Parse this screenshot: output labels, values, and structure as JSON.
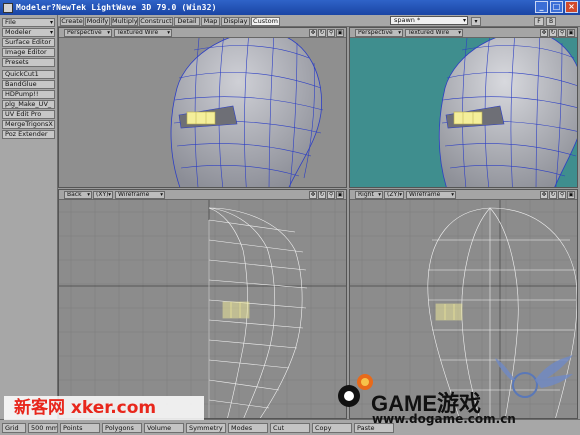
{
  "window": {
    "title": "Modeler?NewTek LightWave 3D 79.0 (Win32)",
    "buttons": [
      "_",
      "□",
      "×"
    ]
  },
  "left_panel": {
    "file": "File",
    "modeler": "Modeler",
    "items": [
      "Surface Editor",
      "Image Editor",
      "Presets"
    ],
    "plugins": [
      "QuickCut1",
      "BandGlue",
      "HDPump!!",
      "plg_Make_UV_",
      "UV Edit Pro",
      "MergeTrigonsX",
      "Poz Extender"
    ]
  },
  "tabs": [
    "Create",
    "Modify",
    "Multiply",
    "Construct",
    "Detail",
    "Map",
    "Display",
    "Custom"
  ],
  "active_tab": "Custom",
  "layer_select": "spawn *",
  "viewports": [
    {
      "view": "Perspective",
      "mode": "Textured Wire",
      "axis": ""
    },
    {
      "view": "Perspective",
      "mode": "Textured Wire",
      "axis": ""
    },
    {
      "view": "Back",
      "axis": "(XY)",
      "mode": "Wireframe"
    },
    {
      "view": "Right",
      "axis": "(ZY)",
      "mode": "Wireframe"
    }
  ],
  "bottom_bar": {
    "items": [
      "Grid",
      "500 mm",
      "Points",
      "Polygons",
      "Volume",
      "Symmetry",
      "Modes",
      "Cut",
      "Copy",
      "Paste"
    ]
  },
  "watermarks": {
    "left": "新客网 xker.com",
    "logo_text": "GAME游戏",
    "url": "www.dogame.com.cn"
  },
  "colors": {
    "title_bar": "#2f63c8",
    "perspective_bg_left": "#8f8f8f",
    "perspective_bg_right": "#3f8e8e",
    "wire_blue": "#2d3fc4",
    "selection_yellow": "#f4ee9a",
    "ortho_bg": "#8c8c8c"
  },
  "icons": [
    "app-icon",
    "minimize-icon",
    "maximize-icon",
    "close-icon",
    "viewport-move-icon",
    "viewport-rotate-icon",
    "viewport-zoom-icon",
    "viewport-maximize-icon"
  ]
}
